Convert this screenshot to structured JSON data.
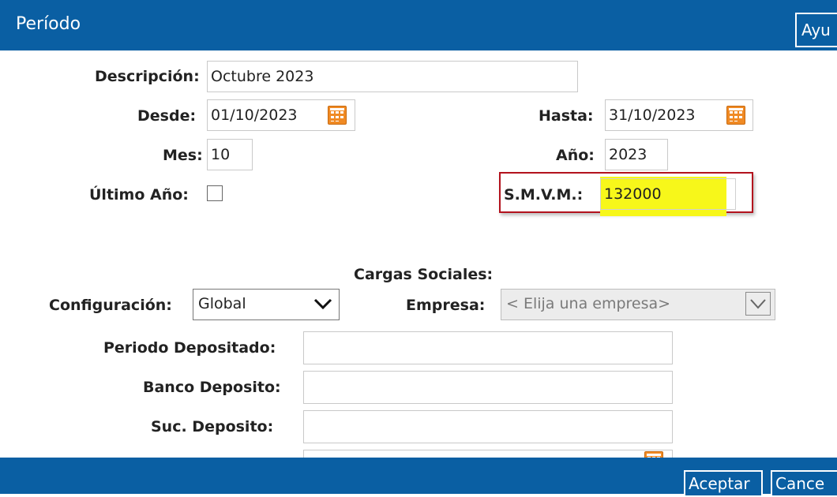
{
  "window": {
    "title": "Período",
    "help_label": "Ayu"
  },
  "form": {
    "descripcion": {
      "label": "Descripción:",
      "value": "Octubre 2023"
    },
    "desde": {
      "label": "Desde:",
      "value": "01/10/2023"
    },
    "hasta": {
      "label": "Hasta:",
      "value": "31/10/2023"
    },
    "mes": {
      "label": "Mes:",
      "value": "10"
    },
    "anio": {
      "label": "Año:",
      "value": "2023"
    },
    "ultimo_anio": {
      "label": "Último Año:",
      "checked": false
    },
    "smvm": {
      "label": "S.M.V.M.:",
      "value": "132000"
    }
  },
  "cargas": {
    "heading": "Cargas Sociales:",
    "configuracion": {
      "label": "Configuración:",
      "value": "Global"
    },
    "empresa": {
      "label": "Empresa:",
      "placeholder": "< Elija una empresa>"
    },
    "periodo_depositado": {
      "label": "Periodo Depositado:",
      "value": ""
    },
    "banco_deposito": {
      "label": "Banco Deposito:",
      "value": ""
    },
    "suc_deposito": {
      "label": "Suc. Deposito:",
      "value": ""
    }
  },
  "footer": {
    "accept_label": "Aceptar",
    "cancel_label": "Cance"
  },
  "colors": {
    "header_bg": "#0a5fa3",
    "highlight": "#f7f71a",
    "focus_border": "#b3121d",
    "calendar_icon": "#f08a24"
  }
}
